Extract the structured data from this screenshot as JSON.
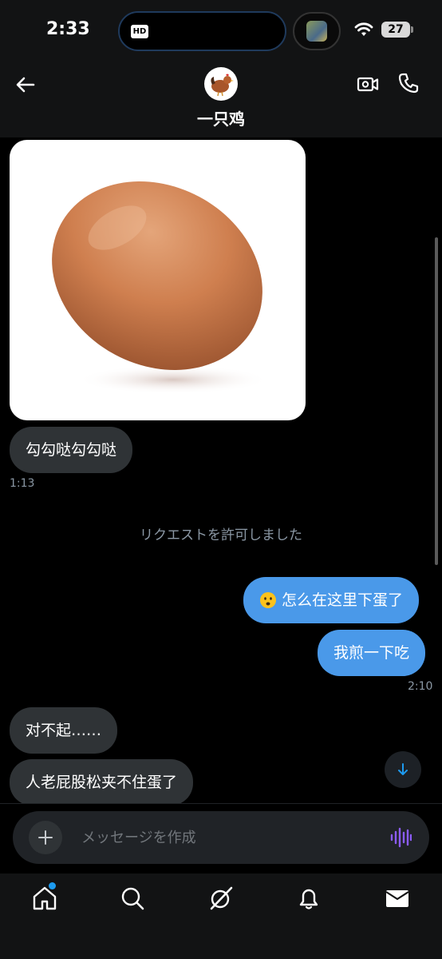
{
  "status_bar": {
    "time": "2:33",
    "hd_label": "HD",
    "battery_level": "27"
  },
  "header": {
    "title": "一只鸡",
    "avatar_icon": "chicken-avatar",
    "icons": [
      "back-arrow-icon",
      "video-camera-icon",
      "phone-icon"
    ]
  },
  "messages": [
    {
      "type": "image",
      "direction": "in",
      "description_icon": "egg-image"
    },
    {
      "type": "text",
      "direction": "in",
      "text": "勾勾哒勾勾哒",
      "time": "1:13"
    },
    {
      "type": "system",
      "text": "リクエストを許可しました"
    },
    {
      "type": "text",
      "direction": "out",
      "emoji": "frowning-face-emoji",
      "text": "怎么在这里下蛋了"
    },
    {
      "type": "text",
      "direction": "out",
      "text": "我煎一下吃",
      "time": "2:10"
    },
    {
      "type": "text",
      "direction": "in",
      "text": "对不起……"
    },
    {
      "type": "text",
      "direction": "in",
      "text": "人老屁股松夹不住蛋了"
    }
  ],
  "composer": {
    "placeholder": "メッセージを作成",
    "icons": [
      "plus-icon",
      "voice-wave-icon"
    ]
  },
  "tab_bar": {
    "tabs": [
      "home-icon",
      "search-icon",
      "grok-icon",
      "bell-icon",
      "mail-icon"
    ],
    "home_has_notification": true
  },
  "colors": {
    "background": "#000000",
    "bar_background": "#121314",
    "incoming_bubble": "#2f3336",
    "outgoing_bubble": "#4a99e9",
    "muted_text": "#8b98a5",
    "voice_accent": "#8b5cf6"
  }
}
